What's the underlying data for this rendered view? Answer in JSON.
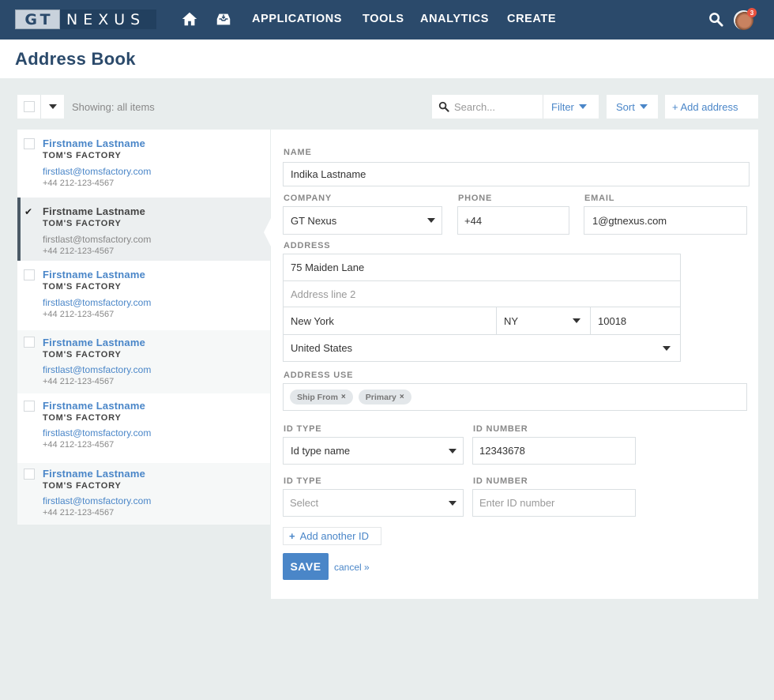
{
  "nav": {
    "logo_gt": "GT",
    "logo_nexus": "NEXUS",
    "home_icon": "home-icon",
    "inbox_icon": "inbox-icon",
    "links": [
      "APPLICATIONS",
      "TOOLS",
      "ANALYTICS",
      "CREATE"
    ],
    "search_icon": "search-icon",
    "notification_count": "3"
  },
  "page": {
    "title": "Address Book"
  },
  "toolbar": {
    "showing": "Showing: all items",
    "search_placeholder": "Search...",
    "filter": "Filter",
    "sort": "Sort",
    "add_address": "+ Add address"
  },
  "contacts": [
    {
      "name": "Firstname Lastname",
      "company": "TOM'S FACTORY",
      "email": "firstlast@tomsfactory.com",
      "phone": "+44 212-123-4567",
      "checked": false
    },
    {
      "name": "Firstname Lastname",
      "company": "TOM'S FACTORY",
      "email": "firstlast@tomsfactory.com",
      "phone": "+44 212-123-4567",
      "checked": true,
      "check_mark": "✔"
    },
    {
      "name": "Firstname Lastname",
      "company": "TOM'S FACTORY",
      "email": "firstlast@tomsfactory.com",
      "phone": "+44 212-123-4567",
      "checked": false
    },
    {
      "name": "Firstname Lastname",
      "company": "TOM'S FACTORY",
      "email": "firstlast@tomsfactory.com",
      "phone": "+44 212-123-4567",
      "checked": false
    },
    {
      "name": "Firstname Lastname",
      "company": "TOM'S FACTORY",
      "email": "firstlast@tomsfactory.com",
      "phone": "+44 212-123-4567",
      "checked": false
    },
    {
      "name": "Firstname Lastname",
      "company": "TOM'S FACTORY",
      "email": "firstlast@tomsfactory.com",
      "phone": "+44 212-123-4567",
      "checked": false
    }
  ],
  "form": {
    "name_label": "NAME",
    "name_value": "Indika Lastname",
    "company_label": "COMPANY",
    "company_value": "GT Nexus",
    "phone_label": "PHONE",
    "phone_value": "+44",
    "email_label": "EMAIL",
    "email_value": "1@gtnexus.com",
    "address_label": "ADDRESS",
    "address_line1": "75 Maiden Lane",
    "address_line2_placeholder": "Address line 2",
    "city": "New York",
    "state": "NY",
    "zip": "10018",
    "country": "United States",
    "address_use_label": "ADDRESS USE",
    "address_use_tags": [
      "Ship From",
      "Primary"
    ],
    "tag_remove": "×",
    "id_type_label": "ID TYPE",
    "id_number_label": "ID NUMBER",
    "id_type_1": "Id type name",
    "id_number_1": "12343678",
    "id_type_2_placeholder": "Select",
    "id_number_2_placeholder": "Enter ID number",
    "add_another_id": "Add another ID",
    "save": "SAVE",
    "cancel": "cancel »"
  },
  "colors": {
    "nav_bg": "#2b4a6b",
    "accent": "#4a86c8",
    "page_bg": "#e8eded"
  }
}
